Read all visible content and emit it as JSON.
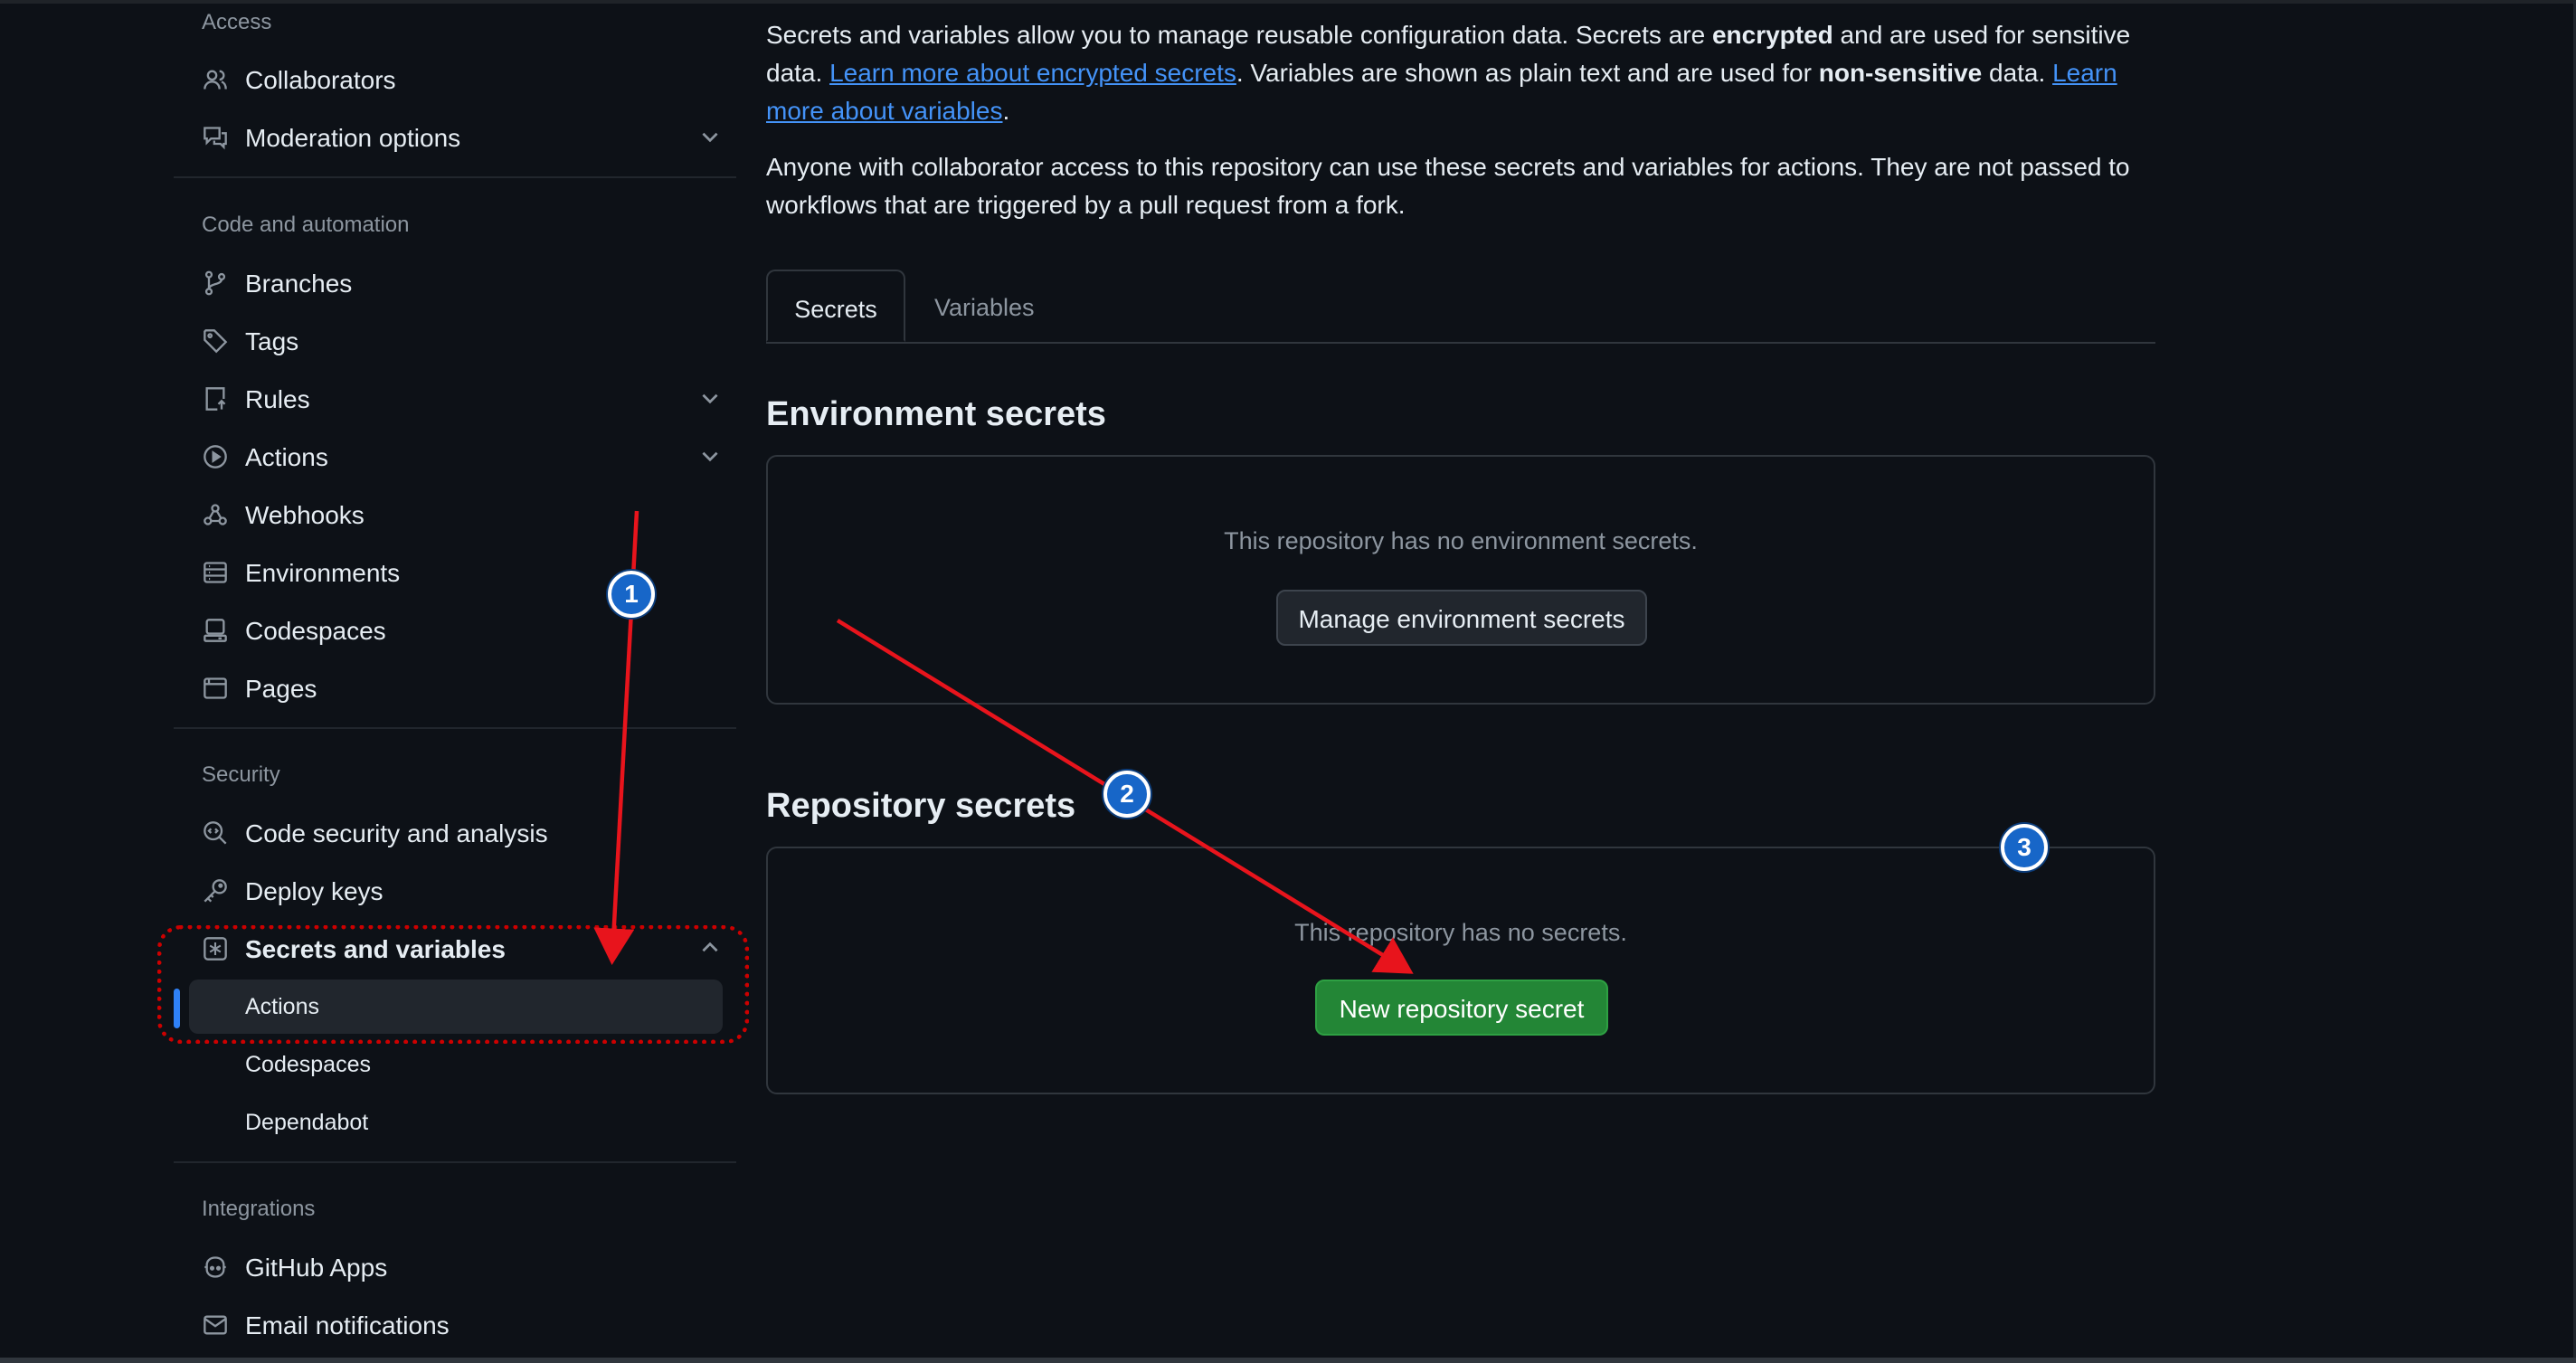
{
  "sidebar": {
    "sections": {
      "access": "Access",
      "code_automation": "Code and automation",
      "security": "Security",
      "integrations": "Integrations"
    },
    "items": {
      "collaborators": "Collaborators",
      "moderation": "Moderation options",
      "branches": "Branches",
      "tags": "Tags",
      "rules": "Rules",
      "actions": "Actions",
      "webhooks": "Webhooks",
      "environments": "Environments",
      "codespaces": "Codespaces",
      "pages": "Pages",
      "code_security": "Code security and analysis",
      "deploy_keys": "Deploy keys",
      "secrets_vars": "Secrets and variables",
      "github_apps": "GitHub Apps",
      "email_notifications": "Email notifications"
    },
    "subitems": {
      "actions": "Actions",
      "codespaces": "Codespaces",
      "dependabot": "Dependabot"
    }
  },
  "main": {
    "intro": {
      "p1_a": "Secrets and variables allow you to manage reusable configuration data. Secrets are ",
      "p1_b": "encrypted",
      "p1_c": " and are used for sensitive data. ",
      "link_secrets": "Learn more about encrypted secrets",
      "p1_d": ". Variables are shown as plain text and are used for ",
      "p1_e": "non-sensitive",
      "p1_f": " data. ",
      "link_variables": "Learn more about variables",
      "p1_g": ".",
      "p2": "Anyone with collaborator access to this repository can use these secrets and variables for actions. They are not passed to workflows that are triggered by a pull request from a fork."
    },
    "tabs": {
      "secrets": "Secrets",
      "variables": "Variables"
    },
    "env": {
      "heading": "Environment secrets",
      "empty": "This repository has no environment secrets.",
      "button": "Manage environment secrets"
    },
    "repo": {
      "heading": "Repository secrets",
      "empty": "This repository has no secrets.",
      "button": "New repository secret"
    }
  },
  "annotations": {
    "step1": "1",
    "step2": "2",
    "step3": "3"
  },
  "colors": {
    "background": "#0d1117",
    "link": "#4493f8",
    "primary_button": "#238636",
    "annotation_arrow": "#e8141c",
    "annotation_badge": "#1766c8",
    "active_indicator": "#2f81f7"
  }
}
